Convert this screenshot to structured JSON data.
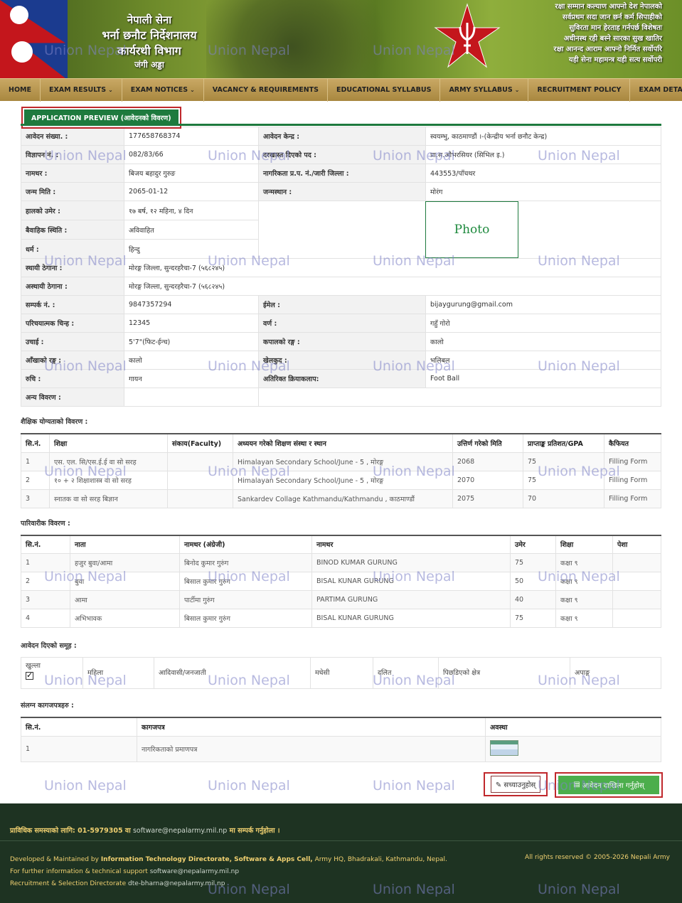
{
  "banner": {
    "title_l1": "नेपाली सेना",
    "title_l2": "भर्ना छनौट निर्देशनालय",
    "title_l3": "कार्यरथी विभाग",
    "title_l4": "जंगी अड्डा",
    "motto": [
      "रक्षा सम्मान कल्याण आफ्नो देश नेपालको",
      "सर्वप्रथम सदा जान छर्न कर्म सिपाहीको",
      "सुविरता मान हेरताह गर्नपर्छ विशेषतः",
      "अधीनस्थ रही बस्ने सारका सुख खातिर",
      "रक्षा आनन्द आराम आफ्नो निर्मित सर्वोपरि",
      "यही सेना महामन्त्र यही सत्य सर्वोपरी"
    ]
  },
  "nav": [
    {
      "label": "HOME",
      "dropdown": false
    },
    {
      "label": "EXAM RESULTS",
      "dropdown": true
    },
    {
      "label": "EXAM NOTICES",
      "dropdown": true
    },
    {
      "label": "VACANCY & REQUIREMENTS",
      "dropdown": false
    },
    {
      "label": "EDUCATIONAL SYLLABUS",
      "dropdown": false
    },
    {
      "label": "ARMY SYLLABUS",
      "dropdown": true
    },
    {
      "label": "RECRUITMENT POLICY",
      "dropdown": false
    },
    {
      "label": "EXAM DETAILS",
      "dropdown": false
    }
  ],
  "page_title": "APPLICATION PREVIEW (आवेदनको विवरण)",
  "info": {
    "application_no": {
      "label": "आवेदन संख्या. :",
      "value": "177658768374"
    },
    "center": {
      "label": "आवेदन केन्द्र :",
      "value": "स्वयम्भु, काठमाण्डौं ।-(केन्द्रीय भर्ना छनौट केन्द्र)"
    },
    "ad_no": {
      "label": "विज्ञापन नं. :",
      "value": "082/83/66"
    },
    "post": {
      "label": "दरखास्त दिएको पद :",
      "value": "प्रा.स.औभरसियर (सिभिल इ.)"
    },
    "name": {
      "label": "नामथर :",
      "value": "बिजय बहादुर गुरुङ"
    },
    "citizenship": {
      "label": "नागरिकता प्र.प. नं./जारी जिल्ला :",
      "value": "443553/पाँचथर"
    },
    "dob": {
      "label": "जन्म मिति :",
      "value": "2065-01-12"
    },
    "birthplace": {
      "label": "जन्मस्थान :",
      "value": "मोरंग"
    },
    "age": {
      "label": "हालको उमेर :",
      "value": "१७ बर्ष, १२ महिना, ४ दिन"
    },
    "marital": {
      "label": "बैवाहिक स्थिति :",
      "value": "अविवाहित"
    },
    "religion": {
      "label": "धर्म :",
      "value": "हिन्दु"
    },
    "perm_address": {
      "label": "स्थायी ठेगाना :",
      "value": "मोरङ्ग जिल्ला, सुन्दरहरैचा-7 (५६८२४५)"
    },
    "temp_address": {
      "label": "अस्थायी ठेगाना :",
      "value": "मोरङ्ग जिल्ला, सुन्दरहरैचा-7 (५६८२४५)"
    },
    "phone": {
      "label": "सम्पर्क नं. :",
      "value": "9847357294"
    },
    "email": {
      "label": "ईमेल :",
      "value": "bijaygurung@gmail.com"
    },
    "id_mark": {
      "label": "परिचयात्मक चिन्ह :",
      "value": "12345"
    },
    "complexion": {
      "label": "वर्ण :",
      "value": "गहुँ गोरो"
    },
    "height": {
      "label": "उचाई :",
      "value": "5'7\"(फिट-ईन्च)"
    },
    "hair": {
      "label": "कपालको रङ्ग :",
      "value": "कालो"
    },
    "eye": {
      "label": "आँखाको रङ्ग :",
      "value": "कालो"
    },
    "sport": {
      "label": "खेलकुद :",
      "value": "भलिबल"
    },
    "interest": {
      "label": "रुचि :",
      "value": "गायन"
    },
    "extra": {
      "label": "अतिरिक्त क्रियाकलाप:",
      "value": "Foot Ball"
    },
    "other": {
      "label": "अन्य विवरण :",
      "value": ""
    },
    "photo": "Photo"
  },
  "education": {
    "title": "शैक्षिक योग्यताको विवरण :",
    "headers": [
      "सि.नं.",
      "शिक्षा",
      "संकाय(Faculty)",
      "अध्ययन गरेको शिक्षण संस्था र स्थान",
      "उत्तिर्ण गरेको मिति",
      "प्राप्ताङ्क प्रतिशत/GPA",
      "कैफियत"
    ],
    "rows": [
      [
        "1",
        "एस. एल. सि/एस.ई.ई वा सो सरह",
        "",
        "Himalayan Secondary School/June - 5 , मोरङ्ग",
        "2068",
        "75",
        "Filling Form"
      ],
      [
        "2",
        "१० + २ शिक्षाशास्त्र वा सो सरह",
        "",
        "Himalayan Secondary School/June - 5 , मोरङ्ग",
        "2070",
        "75",
        "Filling Form"
      ],
      [
        "3",
        "स्नातक वा सो सरह बिज्ञान",
        "",
        "Sankardev Collage Kathmandu/Kathmandu , काठमाण्डौं",
        "2075",
        "70",
        "Filling Form"
      ]
    ]
  },
  "family": {
    "title": "पारिवारीक विवरण :",
    "headers": [
      "सि.नं.",
      "नाता",
      "नामथर (अंग्रेजी)",
      "नामथर",
      "उमेर",
      "शिक्षा",
      "पेशा"
    ],
    "rows": [
      [
        "1",
        "हजुर बुवा/आमा",
        "बिनोद कुमार गुरुंग",
        "BINOD KUMAR GURUNG",
        "75",
        "कक्षा ९",
        ""
      ],
      [
        "2",
        "बुवा",
        "बिसाल कुमार गुरुंग",
        "BISAL KUNAR GURUNG",
        "50",
        "कक्षा ९",
        ""
      ],
      [
        "3",
        "आमा",
        "पार्टीमा गुरुंग",
        "PARTIMA GURUNG",
        "40",
        "कक्षा ९",
        ""
      ],
      [
        "4",
        "अभिभावक",
        "बिसाल कुमार गुरुंग",
        "BISAL KUNAR GURUNG",
        "75",
        "कक्षा ९",
        ""
      ]
    ]
  },
  "groups": {
    "title": "आवेदन दिएको समूह :",
    "items": [
      "खुल्ला",
      "महिला",
      "आदिवासी/जनजाती",
      "मधेसी",
      "दलित",
      "पिछडिएको क्षेत्र",
      "अपाङ्ग"
    ],
    "checked": [
      true,
      false,
      false,
      false,
      false,
      false,
      false
    ]
  },
  "documents": {
    "title": "संलग्न कागजपत्रहरु :",
    "headers": [
      "सि.नं.",
      "कागजपत्र",
      "अवस्था"
    ],
    "rows": [
      [
        "1",
        "नागरिकताको प्रमाणपत्र"
      ]
    ]
  },
  "buttons": {
    "edit": "सच्याउनुहोस्",
    "submit": "आवेदन दाखिला गर्नुहोस्"
  },
  "footer": {
    "support_prefix": "प्राविधिक समस्याको लागि: 01-5979305 वा",
    "support_email": "software@nepalarmy.mil.np",
    "support_suffix": "मा सम्पर्क गर्नुहोला ।",
    "dev_line1_a": "Developed & Maintained by",
    "dev_line1_b": "Information Technology Directorate, Software & Apps Cell,",
    "dev_line1_c": "Army HQ, Bhadrakali, Kathmandu, Nepal.",
    "dev_line2": "For further information & technical support",
    "dev_line2_email": "software@nepalarmy.mil.np",
    "dev_line3": "Recruitment & Selection Directorate",
    "dev_line3_email": "dte-bharna@nepalarmy.mil.np",
    "rights": "All rights reserved © 2005-2026 Nepali Army"
  },
  "watermark": "Union Nepal",
  "colors": {
    "brand_green": "#1e7a3e",
    "nav_gold": "#b89650",
    "footer_dark": "#1e3322",
    "highlight_red": "#c0282c",
    "submit_green": "#4cae4c"
  }
}
